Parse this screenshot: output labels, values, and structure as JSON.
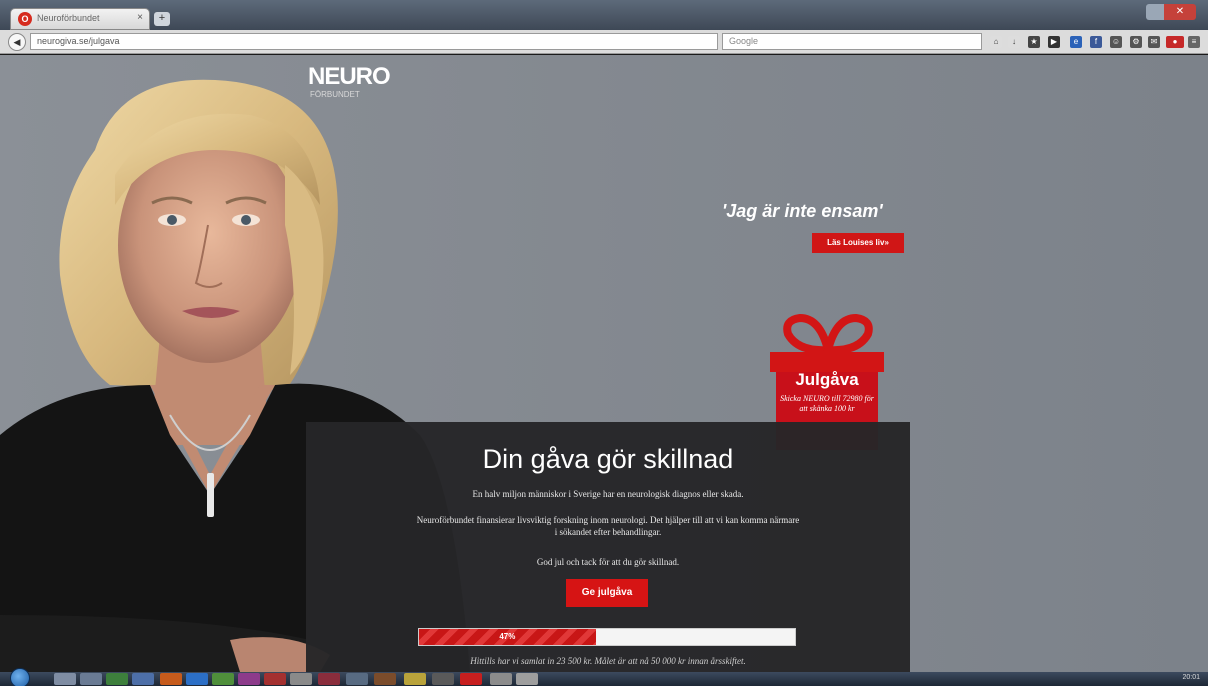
{
  "browser": {
    "tab_title": "Neuroförbundet",
    "tab_icon": "opera-icon",
    "tab_close": "×",
    "newtab": "+",
    "url": "neurogiva.se/julgava",
    "search_placeholder": "Google",
    "close": "✕"
  },
  "site": {
    "logo": "NEURO",
    "logo_sub": "FÖRBUNDET",
    "quote": "'Jag är inte ensam'",
    "read_button": "Läs Louises liv»"
  },
  "gift": {
    "title": "Julgåva",
    "text": "Skicka NEURO till 72980 för att skänka 100 kr",
    "colors": {
      "red": "#d21515"
    }
  },
  "panel": {
    "title": "Din gåva gör skillnad",
    "p1": "En halv miljon människor i Sverige har en neurologisk diagnos eller skada.",
    "p2": "Neuroförbundet finansierar livsviktig forskning inom neurologi. Det hjälper till att vi kan komma närmare i sökandet efter behandlingar.",
    "p3": "God jul och tack för att du gör skillnad.",
    "give_button": "Ge julgåva",
    "progress_label": "47%",
    "progress_fraction": 0.47,
    "caption": "Hittills har vi samlat in 23 500 kr. Målet är att nå 50 000 kr innan årsskiftet."
  },
  "taskbar": {
    "clock": "20:01"
  }
}
